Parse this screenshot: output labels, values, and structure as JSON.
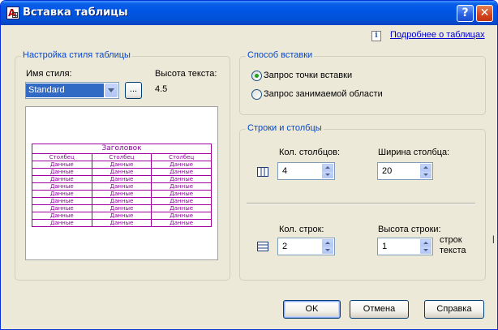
{
  "window": {
    "title": "Вставка таблицы",
    "help_button": "?",
    "close_button": "✕"
  },
  "more_link": "Подробнее о таблицах",
  "style_group": {
    "title": "Настройка стиля таблицы",
    "style_name_label": "Имя стиля:",
    "style_name_value": "Standard",
    "browse_label": "...",
    "text_height_label": "Высота текста:",
    "text_height_value": "4.5",
    "preview": {
      "header": "Заголовок",
      "columns": [
        "Столбец",
        "Столбец",
        "Столбец"
      ],
      "rows": [
        [
          "Данные",
          "Данные",
          "Данные"
        ],
        [
          "Данные",
          "Данные",
          "Данные"
        ],
        [
          "Данные",
          "Данные",
          "Данные"
        ],
        [
          "Данные",
          "Данные",
          "Данные"
        ],
        [
          "Данные",
          "Данные",
          "Данные"
        ],
        [
          "Данные",
          "Данные",
          "Данные"
        ],
        [
          "Данные",
          "Данные",
          "Данные"
        ],
        [
          "Данные",
          "Данные",
          "Данные"
        ],
        [
          "Данные",
          "Данные",
          "Данные"
        ]
      ]
    }
  },
  "insert_group": {
    "title": "Способ вставки",
    "option_point": "Запрос точки вставки",
    "option_area": "Запрос занимаемой области",
    "selected": "point"
  },
  "rows_cols_group": {
    "title": "Строки и столбцы",
    "columns_label": "Кол. столбцов:",
    "columns_value": "4",
    "column_width_label": "Ширина столбца:",
    "column_width_value": "20",
    "rows_label": "Кол. строк:",
    "rows_value": "2",
    "row_height_label": "Высота строки:",
    "row_height_value": "1",
    "row_height_unit": "строк текста"
  },
  "buttons": {
    "ok": "OK",
    "cancel": "Отмена",
    "help": "Справка"
  },
  "outside_mark": "|",
  "colors": {
    "title_bar": "#0055e5",
    "group_title": "#0046d5",
    "preview_table": "#a000a0",
    "link": "#0000cc"
  }
}
